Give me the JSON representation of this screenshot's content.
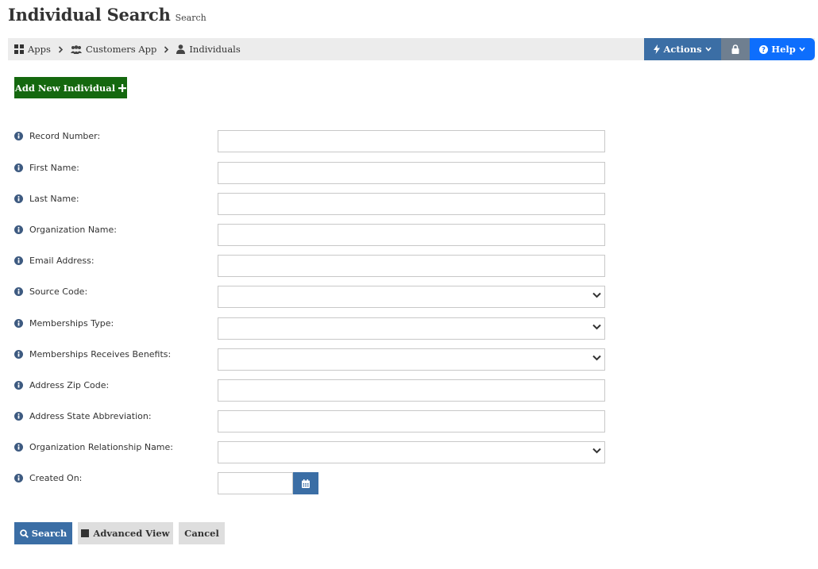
{
  "header": {
    "title": "Individual Search",
    "subtitle": "Search"
  },
  "breadcrumb": [
    {
      "label": "Apps",
      "icon": "grid-icon"
    },
    {
      "label": "Customers App",
      "icon": "users-icon"
    },
    {
      "label": "Individuals",
      "icon": "user-icon"
    }
  ],
  "toolbar": {
    "actions_label": "Actions",
    "help_label": "Help",
    "lock_icon": "lock-icon"
  },
  "add_button_label": "Add New Individual",
  "fields": [
    {
      "label": "Record Number:",
      "type": "text",
      "value": ""
    },
    {
      "label": "First Name:",
      "type": "text",
      "value": ""
    },
    {
      "label": "Last Name:",
      "type": "text",
      "value": ""
    },
    {
      "label": "Organization Name:",
      "type": "text",
      "value": ""
    },
    {
      "label": "Email Address:",
      "type": "text",
      "value": ""
    },
    {
      "label": "Source Code:",
      "type": "select",
      "value": ""
    },
    {
      "label": "Memberships Type:",
      "type": "select",
      "value": ""
    },
    {
      "label": "Memberships Receives Benefits:",
      "type": "select",
      "value": ""
    },
    {
      "label": "Address Zip Code:",
      "type": "text",
      "value": ""
    },
    {
      "label": "Address State Abbreviation:",
      "type": "text",
      "value": ""
    },
    {
      "label": "Organization Relationship Name:",
      "type": "select",
      "value": ""
    },
    {
      "label": "Created On:",
      "type": "date",
      "value": ""
    }
  ],
  "buttons": {
    "search_label": "Search",
    "advanced_label": "Advanced View",
    "cancel_label": "Cancel"
  },
  "colors": {
    "primary_blue": "#3b6ea5",
    "help_blue": "#0d6efd",
    "add_green": "#15680f",
    "lock_gray": "#6f7f90",
    "info_icon": "#3d5a80"
  }
}
